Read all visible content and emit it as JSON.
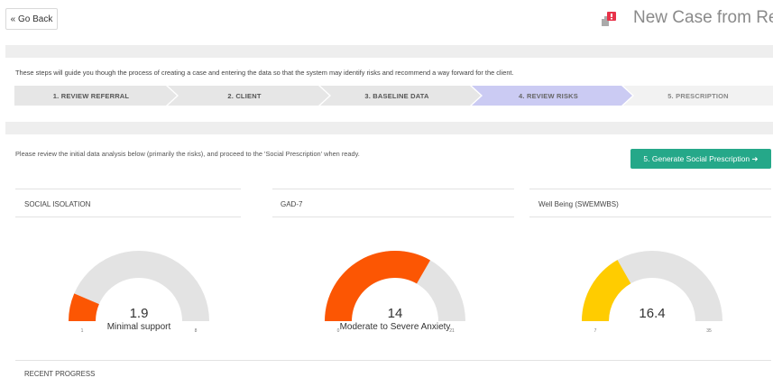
{
  "header": {
    "back_label": "« Go Back",
    "title": "New Case from Referral",
    "icon": "alert-flag-icon"
  },
  "intro_text": "These steps will guide you though the process of creating a case and entering the data so that the system may identify risks and recommend a way forward for the client.",
  "steps": [
    {
      "label": "1. REVIEW REFERRAL",
      "state": "done"
    },
    {
      "label": "2. CLIENT",
      "state": "done"
    },
    {
      "label": "3. BASELINE DATA",
      "state": "done"
    },
    {
      "label": "4. REVIEW RISKS",
      "state": "active"
    },
    {
      "label": "5. PRESCRIPTION",
      "state": "todo"
    }
  ],
  "instruction": "Please review the initial data analysis below (primarily the risks), and proceed to the 'Social Prescription' when ready.",
  "generate_button": "5. Generate Social Prescription ➜",
  "panels": [
    {
      "title": "SOCIAL ISOLATION",
      "value": "1.9",
      "value_num": 1.9,
      "description": "Minimal support",
      "min": "1",
      "max": "8",
      "min_num": 1,
      "max_num": 8,
      "color": "#fc5603"
    },
    {
      "title": "GAD-7",
      "value": "14",
      "value_num": 14,
      "description": "Moderate to Severe Anxiety",
      "min": "0",
      "max": "21",
      "min_num": 0,
      "max_num": 21,
      "color": "#fc5603"
    },
    {
      "title": "Well Being (SWEMWBS)",
      "value": "16.4",
      "value_num": 16.4,
      "description": "",
      "min": "7",
      "max": "35",
      "min_num": 7,
      "max_num": 35,
      "color": "#ffcc00"
    }
  ],
  "recent_progress": "RECENT PROGRESS",
  "colors": {
    "accent": "#25a889",
    "step_done": "#e6e6e6",
    "step_active": "#c8c8f0",
    "step_todo": "#f2f2f2",
    "gauge_track": "#e3e3e3"
  }
}
